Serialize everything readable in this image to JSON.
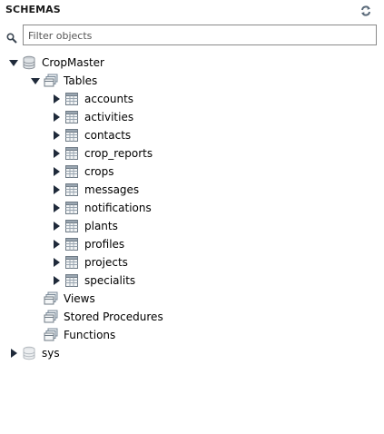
{
  "header": {
    "title": "SCHEMAS"
  },
  "search": {
    "placeholder": "Filter objects",
    "value": ""
  },
  "tree": {
    "schemas": [
      {
        "name": "CropMaster",
        "expanded": true,
        "tables_label": "Tables",
        "tables": [
          "accounts",
          "activities",
          "contacts",
          "crop_reports",
          "crops",
          "messages",
          "notifications",
          "plants",
          "profiles",
          "projects",
          "specialits"
        ],
        "views_label": "Views",
        "procedures_label": "Stored Procedures",
        "functions_label": "Functions"
      },
      {
        "name": "sys",
        "expanded": false
      }
    ]
  },
  "colors": {
    "arrow": "#1f2a3a",
    "db_icon": "#8a9199",
    "table_icon": "#6f7b86",
    "folder_icon": "#7a8a99"
  }
}
